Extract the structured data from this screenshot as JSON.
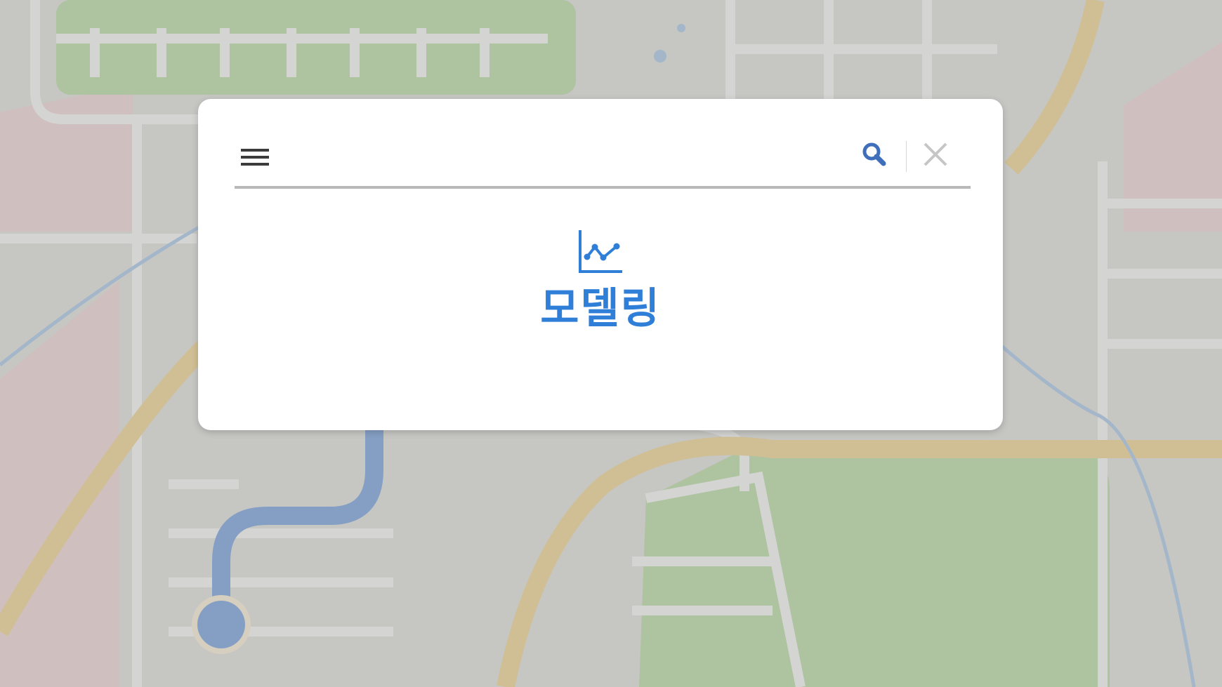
{
  "search": {
    "query": "",
    "placeholder": ""
  },
  "icons": {
    "menu": "hamburger-menu-icon",
    "search": "magnifier-icon",
    "clear": "close-x-icon",
    "feature": "line-chart-icon"
  },
  "feature": {
    "label": "모델링"
  },
  "colors": {
    "accent": "#2f7fd8",
    "search_icon": "#3f6fba",
    "menu_icon": "#3c3c3c",
    "clear_icon": "#c6c6c6",
    "underline": "#b9b9b9",
    "route": "#7fa3d6",
    "road_major": "#e6cf93",
    "park": "#b8d4a3"
  }
}
